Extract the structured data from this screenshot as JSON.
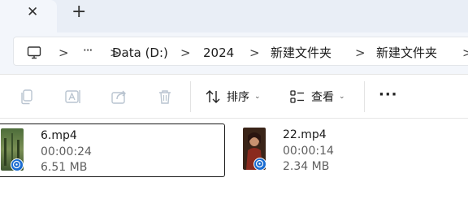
{
  "tabs": {
    "close_glyph": "✕",
    "new_tab_glyph": "+"
  },
  "address_bar": {
    "icon": "pc-icon",
    "separator": ">",
    "more_glyph": "···",
    "crumbs": [
      "Data (D:)",
      "2024",
      "新建文件夹",
      "新建文件夹"
    ]
  },
  "command_bar": {
    "icons": [
      "copy-icon",
      "rename-icon",
      "share-icon",
      "delete-icon"
    ],
    "sort_label": "排序",
    "view_label": "查看",
    "caret": "⌄",
    "more_glyph": "···"
  },
  "files": [
    {
      "name": "6.mp4",
      "duration": "00:00:24",
      "size": "6.51 MB",
      "selected": true
    },
    {
      "name": "22.mp4",
      "duration": "00:00:14",
      "size": "2.34 MB",
      "selected": false
    }
  ],
  "colors": {
    "accent": "#1a6cd1",
    "tab_strip": "#e9eef6",
    "toolbar_bg": "#f3f6fb"
  }
}
